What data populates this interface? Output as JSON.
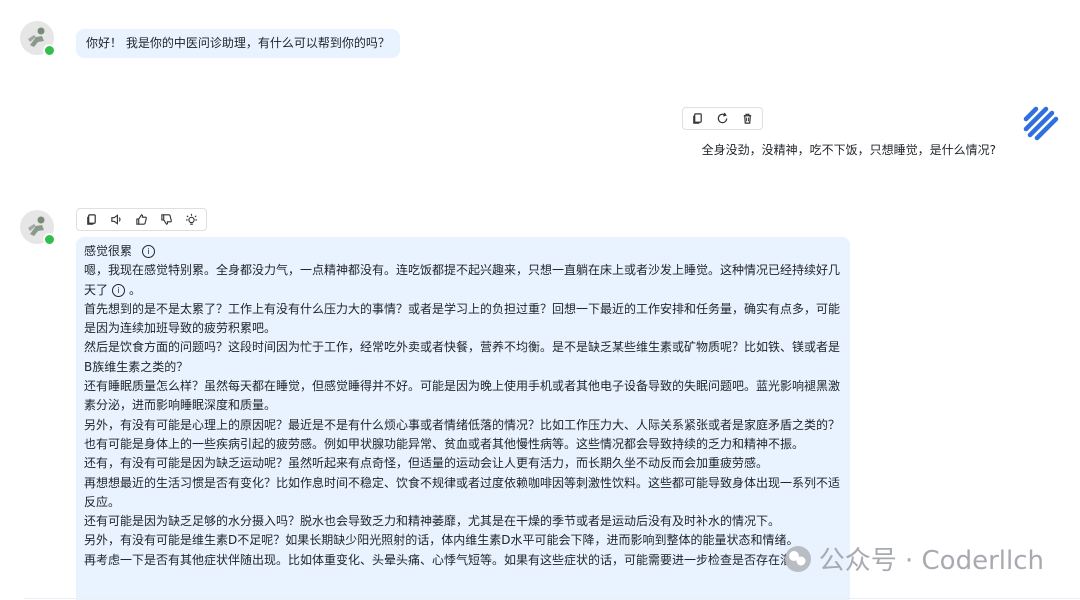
{
  "greeting": {
    "text": "你好！ 我是你的中医问诊助理，有什么可以帮到你的吗？"
  },
  "user_message": {
    "text": "全身没劲，没精神，吃不下饭，只想睡觉，是什么情况?"
  },
  "user_toolbar": {
    "icons": [
      "copy-icon",
      "refresh-icon",
      "delete-icon"
    ]
  },
  "answer_toolbar": {
    "icons": [
      "copy-icon",
      "speaker-icon",
      "thumbs-up-icon",
      "thumbs-down-icon",
      "idea-icon"
    ]
  },
  "answer": {
    "head": "感觉很累",
    "lines": [
      "嗯，我现在感觉特别累。全身都没力气，一点精神都没有。连吃饭都提不起兴趣来，只想一直躺在床上或者沙发上睡觉。这种情况已经持续好几天了",
      "首先想到的是不是太累了？工作上有没有什么压力大的事情？或者是学习上的负担过重？回想一下最近的工作安排和任务量，确实有点多，可能是因为连续加班导致的疲劳积累吧。",
      "然后是饮食方面的问题吗？这段时间因为忙于工作，经常吃外卖或者快餐，营养不均衡。是不是缺乏某些维生素或矿物质呢？比如铁、镁或者是B族维生素之类的？",
      "还有睡眠质量怎么样？虽然每天都在睡觉，但感觉睡得并不好。可能是因为晚上使用手机或者其他电子设备导致的失眠问题吧。蓝光影响褪黑激素分泌，进而影响睡眠深度和质量。",
      "另外，有没有可能是心理上的原因呢？最近是不是有什么烦心事或者情绪低落的情况？比如工作压力大、人际关系紧张或者是家庭矛盾之类的？",
      "也有可能是身体上的一些疾病引起的疲劳感。例如甲状腺功能异常、贫血或者其他慢性病等。这些情况都会导致持续的乏力和精神不振。",
      "还有，有没有可能是因为缺乏运动呢？虽然听起来有点奇怪，但适量的运动会让人更有活力，而长期久坐不动反而会加重疲劳感。",
      "再想想最近的生活习惯是否有变化？比如作息时间不稳定、饮食不规律或者过度依赖咖啡因等刺激性饮料。这些都可能导致身体出现一系列不适反应。",
      "还有可能是因为缺乏足够的水分摄入吗？脱水也会导致乏力和精神萎靡，尤其是在干燥的季节或者是运动后没有及时补水的情况下。",
      "另外，有没有可能是维生素D不足呢？如果长期缺少阳光照射的话，体内维生素D水平可能会下降，进而影响到整体的能量状态和情绪。",
      "再考虑一下是否有其他症状伴随出现。比如体重变化、头晕头痛、心悸气短等。如果有这些症状的话，可能需要进一步检查是否存在潜在"
    ],
    "line1_suffix": "。"
  },
  "watermark": {
    "text": "公众号 · Coderllch"
  }
}
